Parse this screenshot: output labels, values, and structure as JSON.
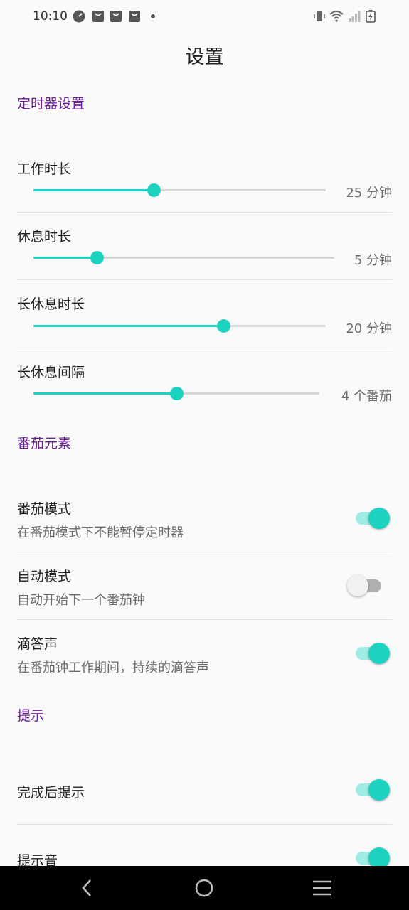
{
  "status": {
    "time": "10:10",
    "left_icons": [
      "speedometer-icon",
      "notification-bag-icon",
      "notification-bag-icon",
      "notification-bag-icon",
      "more-dot-icon"
    ],
    "right_icons": [
      "vibrate-icon",
      "wifi-icon",
      "signal-icon",
      "battery-charging-icon"
    ]
  },
  "page": {
    "title": "设置"
  },
  "timer_section": {
    "header": "定时器设置",
    "items": [
      {
        "title": "工作时长",
        "value_text": "25 分钟",
        "level": 0.41
      },
      {
        "title": "休息时长",
        "value_text": "5 分钟",
        "level": 0.21
      },
      {
        "title": "长休息时长",
        "value_text": "20 分钟",
        "level": 0.65
      },
      {
        "title": "长休息间隔",
        "value_text": "4 个番茄",
        "level": 0.5
      }
    ]
  },
  "tomato_section": {
    "header": "番茄元素",
    "items": [
      {
        "title": "番茄模式",
        "subtitle": "在番茄模式下不能暂停定时器",
        "checked": true
      },
      {
        "title": "自动模式",
        "subtitle": "自动开始下一个番茄钟",
        "checked": false
      },
      {
        "title": "滴答声",
        "subtitle": "在番茄钟工作期间，持续的滴答声",
        "checked": true
      }
    ]
  },
  "hint_section": {
    "header": "提示",
    "items": [
      {
        "title": "完成后提示",
        "checked": true
      },
      {
        "title": "提示音",
        "checked": true
      }
    ]
  },
  "nav": {
    "back": "back-icon",
    "home": "home-icon",
    "menu": "menu-icon"
  },
  "colors": {
    "accent": "#1cd3c2",
    "section_header": "#6a1b9a",
    "background": "#fafafa"
  }
}
